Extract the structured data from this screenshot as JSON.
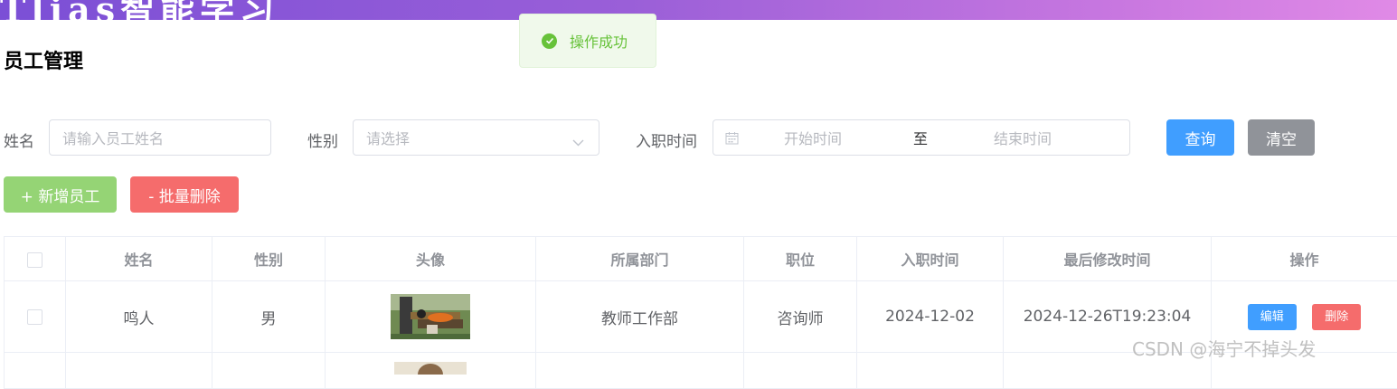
{
  "header": {
    "brand": "Tlias智能学习"
  },
  "toast": {
    "message": "操作成功",
    "icon": "check-circle-icon",
    "color": "#67c23a"
  },
  "page": {
    "title": "员工管理"
  },
  "search": {
    "name_label": "姓名",
    "name_placeholder": "请输入员工姓名",
    "gender_label": "性别",
    "gender_placeholder": "请选择",
    "date_label": "入职时间",
    "start_placeholder": "开始时间",
    "range_separator": "至",
    "end_placeholder": "结束时间",
    "query_label": "查询",
    "clear_label": "清空"
  },
  "actions": {
    "add_label": "+ 新增员工",
    "batch_delete_label": "- 批量删除"
  },
  "table": {
    "columns": [
      "姓名",
      "性别",
      "头像",
      "所属部门",
      "职位",
      "入职时间",
      "最后修改时间",
      "操作"
    ],
    "rows": [
      {
        "name": "鸣人",
        "gender": "男",
        "department": "教师工作部",
        "position": "咨询师",
        "entry_date": "2024-12-02",
        "update_time": "2024-12-26T19:23:04",
        "edit_label": "编辑",
        "delete_label": "删除"
      }
    ]
  },
  "watermark": "CSDN @海宁不掉头发",
  "colors": {
    "primary": "#409eff",
    "success": "#67c23a",
    "danger": "#f56c6c",
    "info": "#909399",
    "header_gradient_start": "#7b4fd6",
    "header_gradient_end": "#e08ae6"
  }
}
